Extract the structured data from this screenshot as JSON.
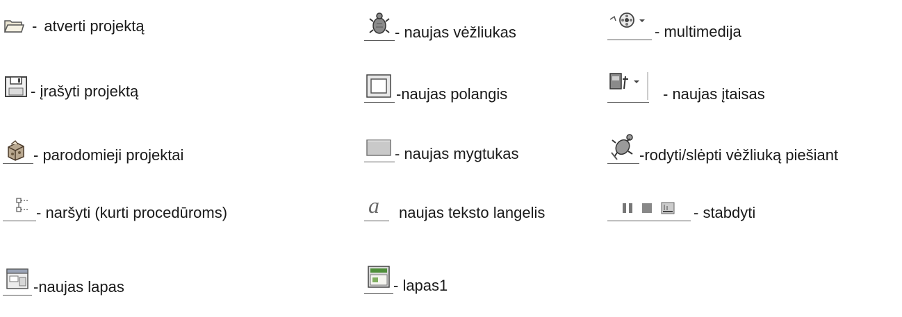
{
  "items": [
    {
      "icon": "open-folder-icon",
      "label": "atverti projektą",
      "dash": "-"
    },
    {
      "icon": "save-disk-icon",
      "label": "- įrašyti projektą"
    },
    {
      "icon": "samples-box-icon",
      "label": "- parodomieji projektai"
    },
    {
      "icon": "procedure-tree-icon",
      "label": "- naršyti (kurti procedūroms)"
    },
    {
      "icon": "new-page-icon",
      "label": "-naujas lapas"
    },
    {
      "icon": "turtle-icon",
      "label": "- naujas vėžliukas"
    },
    {
      "icon": "window-frame-icon",
      "label": "-naujas polangis"
    },
    {
      "icon": "button-icon",
      "label": "- naujas mygtukas"
    },
    {
      "icon": "text-a-icon",
      "label": "naujas teksto langelis"
    },
    {
      "icon": "page1-icon",
      "label": "- lapas1"
    },
    {
      "icon": "multimedia-film-icon",
      "label": "- multimedija"
    },
    {
      "icon": "device-icon",
      "label": "- naujas įtaisas"
    },
    {
      "icon": "show-hide-turtle-icon",
      "label": "-rodyti/slėpti vėžliuką piešiant"
    },
    {
      "icon": "pause-stop-run-icon",
      "label": "- stabdyti"
    }
  ]
}
